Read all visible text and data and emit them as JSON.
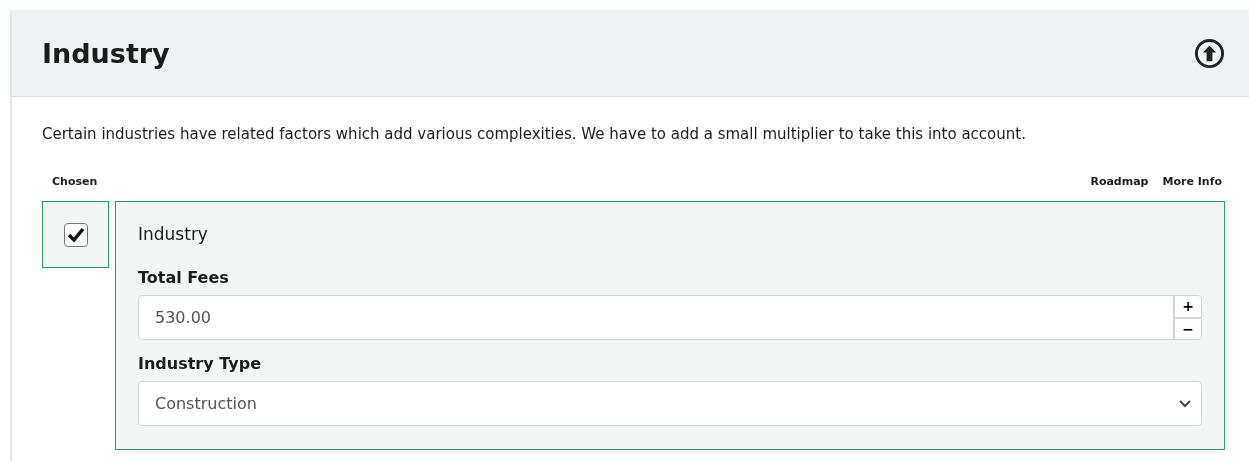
{
  "panel": {
    "title": "Industry"
  },
  "description": "Certain industries have related factors which add various complexities. We have to add a small multiplier to take this into account.",
  "columns": {
    "left": "Chosen",
    "right": [
      "Roadmap",
      "More Info"
    ]
  },
  "item": {
    "chosen": true,
    "title": "Industry",
    "fees": {
      "label": "Total Fees",
      "value": "530.00",
      "increment": "+",
      "decrement": "−"
    },
    "type": {
      "label": "Industry Type",
      "value": "Construction"
    }
  }
}
